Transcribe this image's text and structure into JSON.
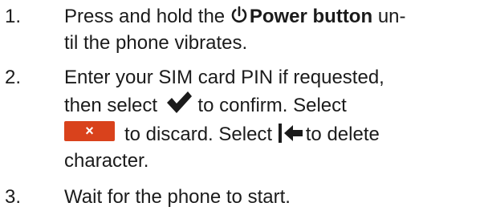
{
  "steps": [
    {
      "number": "1.",
      "pre": "Press and hold the",
      "power_label": "Power button",
      "post": "un-",
      "line2": "til the phone vibrates."
    },
    {
      "number": "2.",
      "line1": "Enter your SIM card PIN if requested,",
      "line2_pre": "then select",
      "line2_post": "to confirm. Select",
      "discard_symbol": "×",
      "line3_post": "to discard. Select",
      "line3_end": "to delete",
      "line4": "character."
    },
    {
      "number": "3.",
      "line1": "Wait for the phone to start."
    }
  ],
  "icons": {
    "power": "power-icon",
    "confirm": "checkmark-icon",
    "discard": "close-icon",
    "delete": "backspace-icon"
  },
  "colors": {
    "text": "#1b1b1b",
    "discard_button": "#d9421c"
  }
}
